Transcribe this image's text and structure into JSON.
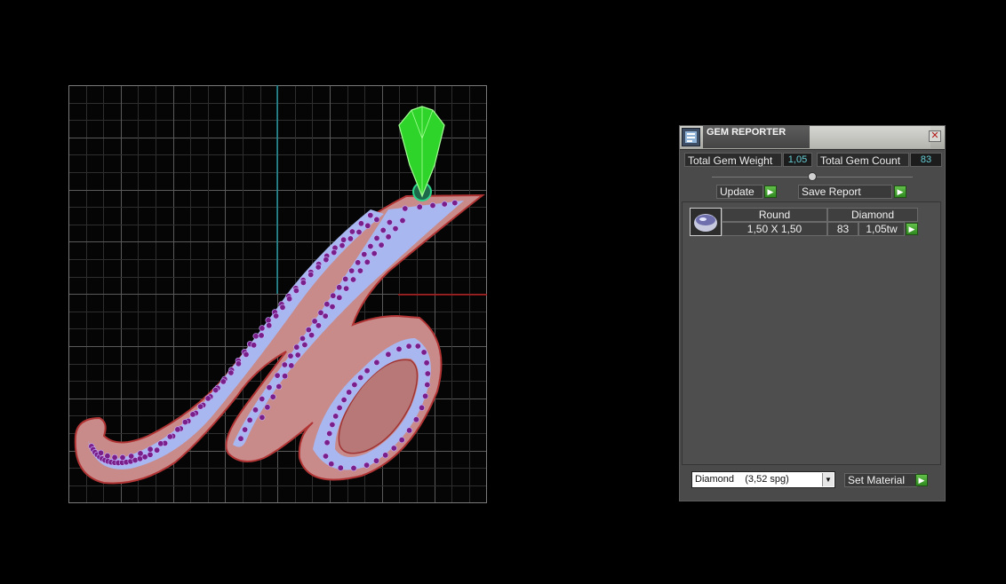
{
  "panel": {
    "title": "GEM REPORTER",
    "close_glyph": "✕",
    "total_gem_weight_label": "Total Gem Weight",
    "total_gem_weight_value": "1,05",
    "total_gem_count_label": "Total Gem Count",
    "total_gem_count_value": "83",
    "update_label": "Update",
    "save_report_label": "Save Report",
    "go_glyph": "▶",
    "collapse_glyph": "▴",
    "report_rows": [
      {
        "shape": "Round",
        "material": "Diamond",
        "size": "1,50 X 1,50",
        "count": "83",
        "weight": "1,05tw"
      }
    ],
    "material_select_value": "Diamond    (3,52 spg)",
    "select_arrow": "▼",
    "set_material_label": "Set Material"
  },
  "colors": {
    "accent_go": "#3fa52b",
    "value_text": "#66cdd5",
    "pendant_metal": "#c98a8a",
    "pave_fill": "#a8b7f0",
    "gem": "#7a1f8a",
    "bail": "#38e03c"
  },
  "icons": {
    "title": "gem-reporter-icon",
    "close": "close-icon",
    "go": "play-arrow-icon",
    "gem_thumb": "round-gem-icon"
  }
}
